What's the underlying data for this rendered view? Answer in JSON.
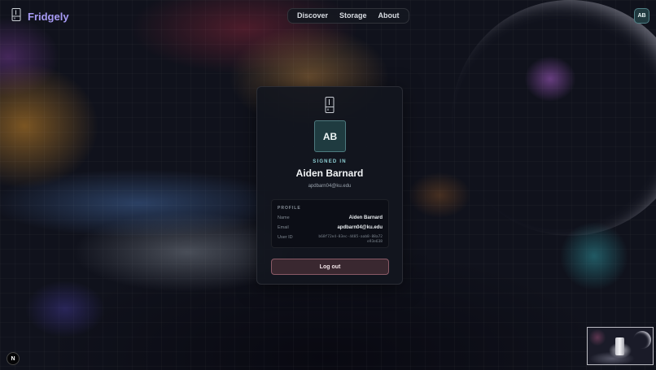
{
  "app": {
    "name": "Fridgely",
    "logo_icon": "fridge-icon"
  },
  "nav": {
    "items": [
      "Discover",
      "Storage",
      "About"
    ]
  },
  "header": {
    "user_initials": "AB"
  },
  "card": {
    "avatar_initials": "AB",
    "status_label": "SIGNED IN",
    "name": "Aiden Barnard",
    "email": "apdbarn04@ku.edu",
    "profile": {
      "title": "PROFILE",
      "rows": [
        {
          "label": "Name",
          "value": "Aiden Barnard"
        },
        {
          "label": "Email",
          "value": "apdbarn04@ku.edu"
        },
        {
          "label": "User ID",
          "value": "b68f72e4-83ec-4485-aab8-88a72e93e638"
        }
      ]
    },
    "logout_label": "Log out"
  },
  "corner_badge": "N",
  "colors": {
    "brand": "#a79bf5",
    "accent": "#8fd1d6",
    "danger": "#8a5a66"
  }
}
